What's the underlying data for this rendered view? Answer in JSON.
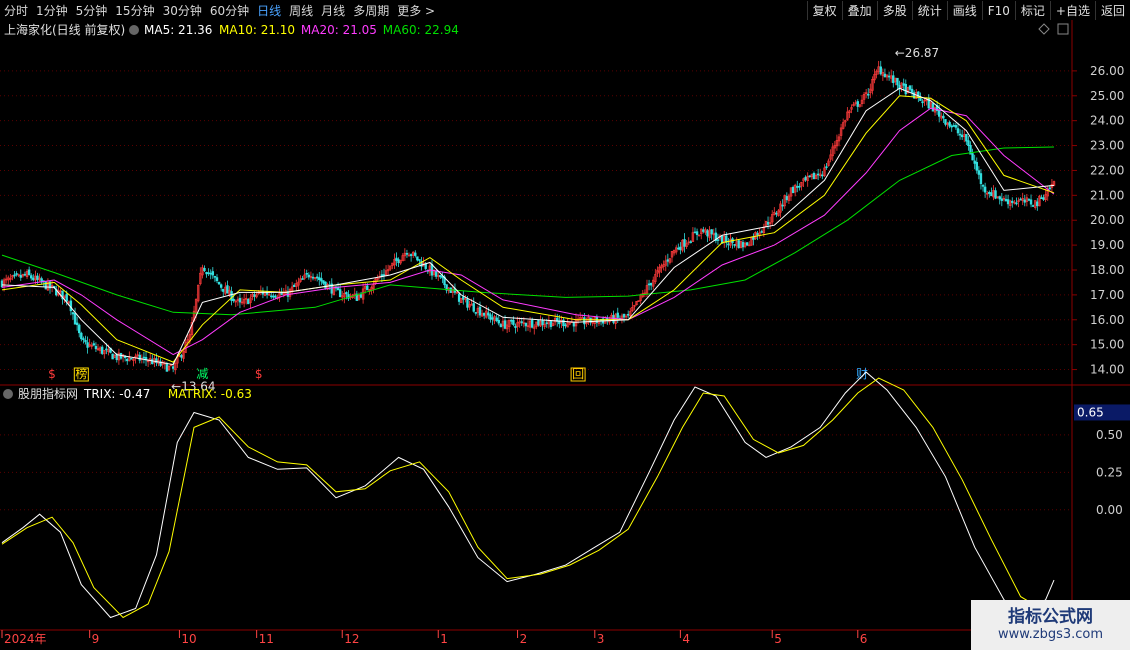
{
  "toolbar": {
    "periods": [
      "分时",
      "1分钟",
      "5分钟",
      "15分钟",
      "30分钟",
      "60分钟",
      "日线",
      "周线",
      "月线",
      "多周期",
      "更多 >"
    ],
    "active_index": 6,
    "right": [
      "复权",
      "叠加",
      "多股",
      "统计",
      "画线",
      "F10",
      "标记",
      "+自选",
      "返回"
    ]
  },
  "colors": {
    "bg": "#000000",
    "grid": "#5a0000",
    "border": "#8b0000",
    "up": "#ff3b3b",
    "down": "#33e0e0",
    "ma5": "#ffffff",
    "ma10": "#ffff00",
    "ma20": "#ff3cff",
    "ma60": "#00e000",
    "trix": "#ffffff",
    "matrix": "#ffff00",
    "axis_text": "#d0d0d0"
  },
  "chart_data": [
    {
      "type": "candlestick",
      "title": "上海家化(日线 前复权)",
      "legend": [
        {
          "name": "MA5",
          "value": "21.36",
          "color": "#ffffff"
        },
        {
          "name": "MA10",
          "value": "21.10",
          "color": "#ffff00"
        },
        {
          "name": "MA20",
          "value": "21.05",
          "color": "#ff3cff"
        },
        {
          "name": "MA60",
          "value": "22.94",
          "color": "#00e000"
        }
      ],
      "ylim": [
        13.5,
        27.0
      ],
      "yticks": [
        "14.00",
        "15.00",
        "16.00",
        "17.00",
        "18.00",
        "19.00",
        "20.00",
        "21.00",
        "22.00",
        "23.00",
        "24.00",
        "25.00",
        "26.00"
      ],
      "grid": true,
      "close_path": [
        [
          0,
          17.5
        ],
        [
          12,
          17.8
        ],
        [
          25,
          17.2
        ],
        [
          32,
          16.8
        ],
        [
          38,
          15.1
        ],
        [
          55,
          14.5
        ],
        [
          70,
          14.4
        ],
        [
          82,
          14.0
        ],
        [
          90,
          15.3
        ],
        [
          96,
          18.2
        ],
        [
          102,
          17.6
        ],
        [
          114,
          16.6
        ],
        [
          124,
          17.1
        ],
        [
          136,
          17.0
        ],
        [
          148,
          17.9
        ],
        [
          160,
          17.1
        ],
        [
          170,
          16.9
        ],
        [
          186,
          18.1
        ],
        [
          194,
          18.8
        ],
        [
          205,
          18.0
        ],
        [
          220,
          16.8
        ],
        [
          240,
          15.8
        ],
        [
          260,
          15.9
        ],
        [
          275,
          15.9
        ],
        [
          290,
          16.0
        ],
        [
          300,
          16.1
        ],
        [
          310,
          17.4
        ],
        [
          322,
          18.8
        ],
        [
          335,
          19.6
        ],
        [
          345,
          19.2
        ],
        [
          356,
          19.0
        ],
        [
          370,
          20.2
        ],
        [
          378,
          21.2
        ],
        [
          394,
          22.0
        ],
        [
          405,
          24.3
        ],
        [
          414,
          25.0
        ],
        [
          420,
          26.1
        ],
        [
          430,
          25.4
        ],
        [
          445,
          24.6
        ],
        [
          462,
          23.2
        ],
        [
          470,
          21.3
        ],
        [
          480,
          20.8
        ],
        [
          496,
          20.7
        ],
        [
          504,
          21.5
        ]
      ],
      "ma5_path": [
        [
          0,
          17.4
        ],
        [
          25,
          17.3
        ],
        [
          38,
          16.0
        ],
        [
          55,
          14.6
        ],
        [
          82,
          14.2
        ],
        [
          96,
          16.7
        ],
        [
          114,
          17.1
        ],
        [
          136,
          17.1
        ],
        [
          160,
          17.4
        ],
        [
          186,
          17.8
        ],
        [
          205,
          18.3
        ],
        [
          220,
          17.0
        ],
        [
          240,
          16.1
        ],
        [
          275,
          15.9
        ],
        [
          300,
          16.0
        ],
        [
          322,
          18.1
        ],
        [
          345,
          19.4
        ],
        [
          370,
          19.8
        ],
        [
          394,
          21.6
        ],
        [
          414,
          24.4
        ],
        [
          430,
          25.3
        ],
        [
          445,
          24.8
        ],
        [
          462,
          23.6
        ],
        [
          480,
          21.2
        ],
        [
          504,
          21.4
        ]
      ],
      "ma10_path": [
        [
          0,
          17.2
        ],
        [
          25,
          17.5
        ],
        [
          38,
          16.6
        ],
        [
          55,
          15.2
        ],
        [
          82,
          14.3
        ],
        [
          96,
          15.8
        ],
        [
          114,
          17.2
        ],
        [
          136,
          17.1
        ],
        [
          160,
          17.4
        ],
        [
          186,
          17.6
        ],
        [
          205,
          18.5
        ],
        [
          220,
          17.6
        ],
        [
          240,
          16.5
        ],
        [
          275,
          16.0
        ],
        [
          300,
          16.0
        ],
        [
          322,
          17.2
        ],
        [
          345,
          19.1
        ],
        [
          370,
          19.5
        ],
        [
          394,
          21.0
        ],
        [
          414,
          23.5
        ],
        [
          430,
          25.0
        ],
        [
          445,
          24.9
        ],
        [
          462,
          24.0
        ],
        [
          480,
          21.8
        ],
        [
          504,
          21.1
        ]
      ],
      "ma20_path": [
        [
          0,
          17.3
        ],
        [
          25,
          17.6
        ],
        [
          38,
          17.0
        ],
        [
          55,
          16.0
        ],
        [
          82,
          14.6
        ],
        [
          96,
          15.2
        ],
        [
          114,
          16.3
        ],
        [
          136,
          17.0
        ],
        [
          160,
          17.3
        ],
        [
          186,
          17.5
        ],
        [
          205,
          18.0
        ],
        [
          220,
          17.8
        ],
        [
          240,
          16.8
        ],
        [
          275,
          16.2
        ],
        [
          300,
          16.0
        ],
        [
          322,
          16.9
        ],
        [
          345,
          18.2
        ],
        [
          370,
          19.0
        ],
        [
          394,
          20.2
        ],
        [
          414,
          21.9
        ],
        [
          430,
          23.6
        ],
        [
          445,
          24.5
        ],
        [
          462,
          24.2
        ],
        [
          480,
          22.6
        ],
        [
          504,
          21.05
        ]
      ],
      "ma60_path": [
        [
          0,
          18.6
        ],
        [
          25,
          17.9
        ],
        [
          55,
          17.0
        ],
        [
          82,
          16.3
        ],
        [
          110,
          16.2
        ],
        [
          150,
          16.5
        ],
        [
          186,
          17.4
        ],
        [
          230,
          17.1
        ],
        [
          270,
          16.9
        ],
        [
          300,
          16.95
        ],
        [
          330,
          17.2
        ],
        [
          356,
          17.6
        ],
        [
          380,
          18.7
        ],
        [
          405,
          20.0
        ],
        [
          430,
          21.6
        ],
        [
          455,
          22.6
        ],
        [
          480,
          22.9
        ],
        [
          504,
          22.94
        ]
      ],
      "annotations": [
        {
          "text": "26.87",
          "bar": 421,
          "value": 26.87
        },
        {
          "text": "13.64",
          "bar": 82,
          "value": 13.64
        }
      ],
      "event_markers": [
        {
          "text": "榜",
          "bar": 38,
          "color": "#ffdd00",
          "boxed": true
        },
        {
          "text": "减",
          "bar": 96,
          "color": "#00ff66",
          "boxed": false
        },
        {
          "text": "$",
          "bar": 124,
          "color": "#ff3b3b",
          "boxed": false
        },
        {
          "text": "$",
          "bar": 25,
          "color": "#ff3b3b",
          "boxed": false
        },
        {
          "text": "回",
          "bar": 276,
          "color": "#ffcc00",
          "boxed": true
        },
        {
          "text": "财",
          "bar": 412,
          "color": "#33aaff",
          "boxed": false
        }
      ]
    },
    {
      "type": "line",
      "title": "股朋指标网",
      "legend": [
        {
          "name": "TRIX",
          "value": "-0.47",
          "color": "#ffffff"
        },
        {
          "name": "MATRIX",
          "value": "-0.63",
          "color": "#ffff00"
        }
      ],
      "yticks": [
        "0.00",
        "0.25",
        "0.50"
      ],
      "current_tag": "0.65",
      "ylim": [
        -0.75,
        0.72
      ],
      "series": [
        {
          "name": "TRIX",
          "color": "#ffffff",
          "values": [
            [
              0,
              -0.22
            ],
            [
              10,
              -0.12
            ],
            [
              18,
              -0.03
            ],
            [
              28,
              -0.15
            ],
            [
              38,
              -0.5
            ],
            [
              52,
              -0.72
            ],
            [
              64,
              -0.66
            ],
            [
              74,
              -0.3
            ],
            [
              84,
              0.45
            ],
            [
              92,
              0.65
            ],
            [
              104,
              0.6
            ],
            [
              118,
              0.35
            ],
            [
              132,
              0.27
            ],
            [
              146,
              0.28
            ],
            [
              160,
              0.08
            ],
            [
              174,
              0.16
            ],
            [
              190,
              0.35
            ],
            [
              202,
              0.27
            ],
            [
              214,
              0.02
            ],
            [
              228,
              -0.32
            ],
            [
              242,
              -0.48
            ],
            [
              256,
              -0.43
            ],
            [
              270,
              -0.37
            ],
            [
              284,
              -0.25
            ],
            [
              296,
              -0.15
            ],
            [
              310,
              0.25
            ],
            [
              322,
              0.6
            ],
            [
              332,
              0.82
            ],
            [
              342,
              0.76
            ],
            [
              356,
              0.45
            ],
            [
              366,
              0.35
            ],
            [
              378,
              0.42
            ],
            [
              392,
              0.55
            ],
            [
              404,
              0.78
            ],
            [
              414,
              0.92
            ],
            [
              424,
              0.8
            ],
            [
              438,
              0.55
            ],
            [
              452,
              0.22
            ],
            [
              466,
              -0.25
            ],
            [
              480,
              -0.6
            ],
            [
              488,
              -0.72
            ],
            [
              500,
              -0.6
            ],
            [
              504,
              -0.47
            ]
          ]
        },
        {
          "name": "MATRIX",
          "color": "#ffff00",
          "values": [
            [
              0,
              -0.23
            ],
            [
              12,
              -0.12
            ],
            [
              24,
              -0.05
            ],
            [
              34,
              -0.22
            ],
            [
              44,
              -0.52
            ],
            [
              58,
              -0.72
            ],
            [
              70,
              -0.63
            ],
            [
              80,
              -0.28
            ],
            [
              92,
              0.55
            ],
            [
              104,
              0.62
            ],
            [
              118,
              0.42
            ],
            [
              132,
              0.32
            ],
            [
              146,
              0.3
            ],
            [
              160,
              0.12
            ],
            [
              174,
              0.14
            ],
            [
              186,
              0.26
            ],
            [
              200,
              0.32
            ],
            [
              214,
              0.12
            ],
            [
              228,
              -0.25
            ],
            [
              242,
              -0.46
            ],
            [
              258,
              -0.43
            ],
            [
              272,
              -0.37
            ],
            [
              286,
              -0.27
            ],
            [
              300,
              -0.13
            ],
            [
              314,
              0.22
            ],
            [
              326,
              0.55
            ],
            [
              336,
              0.78
            ],
            [
              346,
              0.76
            ],
            [
              360,
              0.47
            ],
            [
              372,
              0.38
            ],
            [
              384,
              0.43
            ],
            [
              398,
              0.6
            ],
            [
              410,
              0.78
            ],
            [
              420,
              0.88
            ],
            [
              432,
              0.8
            ],
            [
              446,
              0.55
            ],
            [
              460,
              0.2
            ],
            [
              474,
              -0.2
            ],
            [
              488,
              -0.58
            ],
            [
              500,
              -0.68
            ],
            [
              504,
              -0.63
            ]
          ]
        }
      ]
    }
  ],
  "xaxis": {
    "labels": [
      {
        "text": "2024年",
        "bar": 0
      },
      {
        "text": "9",
        "bar": 42
      },
      {
        "text": "10",
        "bar": 85
      },
      {
        "text": "11",
        "bar": 122
      },
      {
        "text": "12",
        "bar": 163
      },
      {
        "text": "1",
        "bar": 209
      },
      {
        "text": "2",
        "bar": 247
      },
      {
        "text": "3",
        "bar": 284
      },
      {
        "text": "4",
        "bar": 325
      },
      {
        "text": "5",
        "bar": 369
      },
      {
        "text": "6",
        "bar": 410
      }
    ],
    "bar_count": 505
  },
  "watermark": {
    "title": "指标公式网",
    "url": "www.zbgs3.com"
  }
}
